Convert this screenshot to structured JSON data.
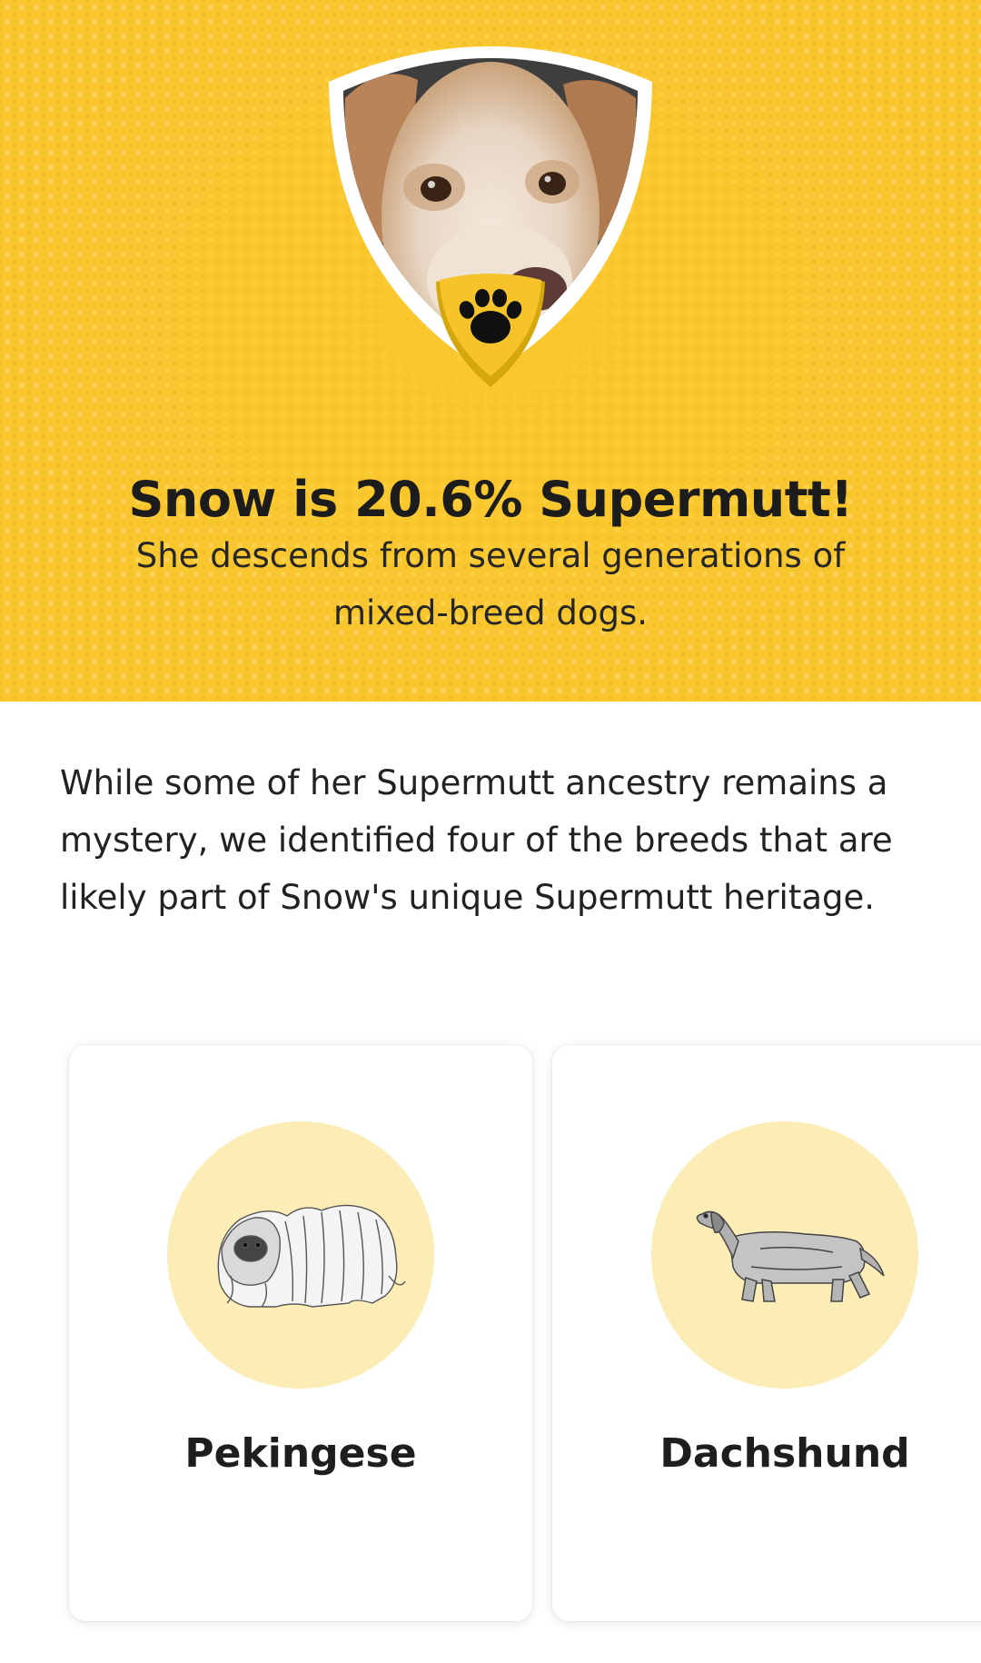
{
  "hero": {
    "title": "Snow is 20.6% Supermutt!",
    "subtitle": "She descends from several generations of mixed-breed dogs.",
    "background_color": "#f8c62e",
    "badge_icon": "paw-print-icon"
  },
  "intro": {
    "text": "While some of her Supermutt ancestry remains a mystery, we identified four of the breeds that are likely part of Snow's unique Supermutt heritage."
  },
  "breeds": [
    {
      "name": "Pekingese",
      "icon": "pekingese-illustration"
    },
    {
      "name": "Dachshund",
      "icon": "dachshund-illustration"
    }
  ],
  "colors": {
    "accent_yellow": "#f8c62e",
    "breed_circle": "#fcecb5",
    "text_dark": "#1f1f1f"
  }
}
